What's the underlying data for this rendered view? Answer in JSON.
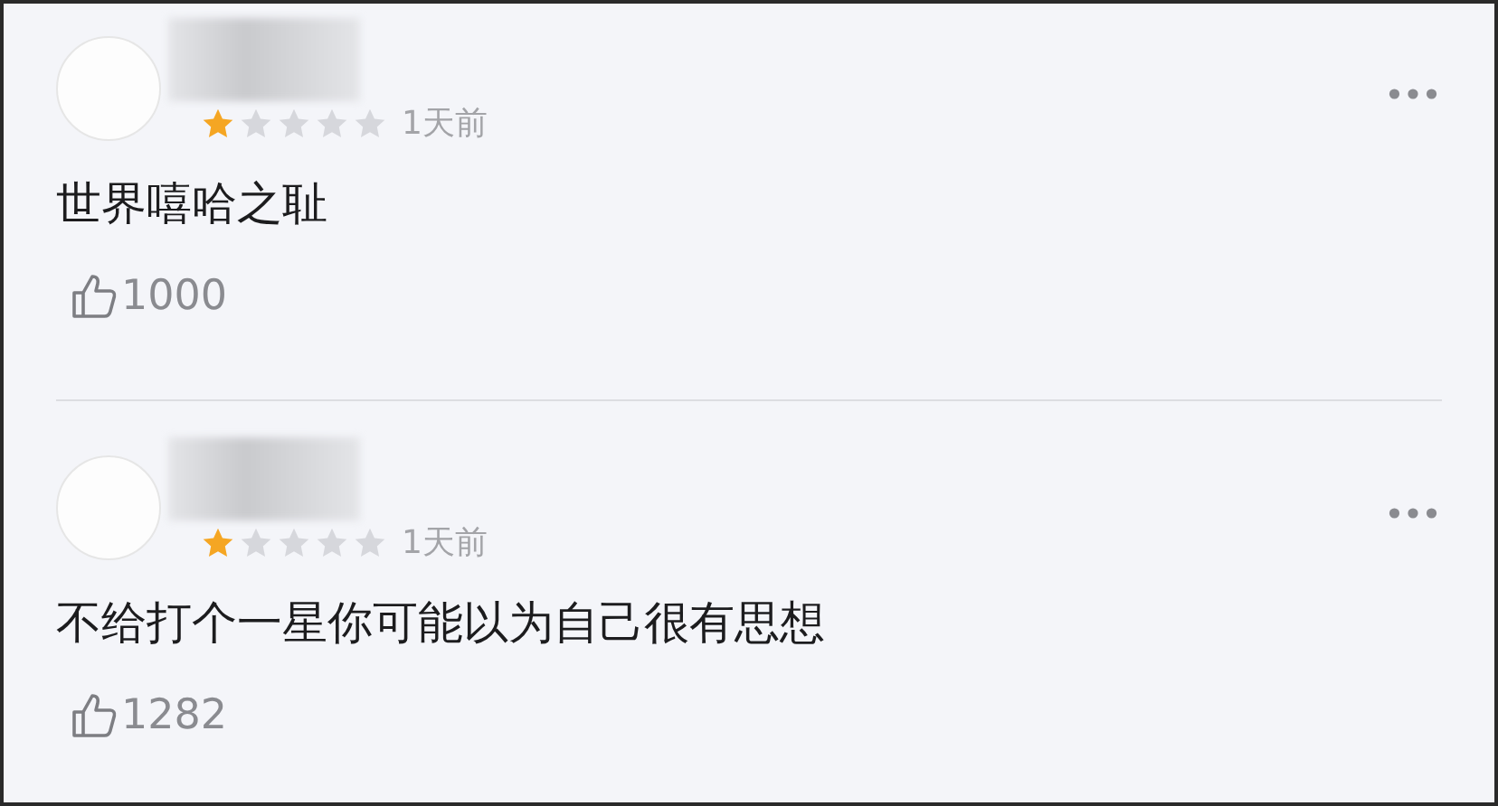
{
  "comments": [
    {
      "stars": 1,
      "time": "1天前",
      "text": "世界嘻哈之耻",
      "likes": "1000"
    },
    {
      "stars": 1,
      "time": "1天前",
      "text": "不给打个一星你可能以为自己很有思想",
      "likes": "1282"
    }
  ]
}
